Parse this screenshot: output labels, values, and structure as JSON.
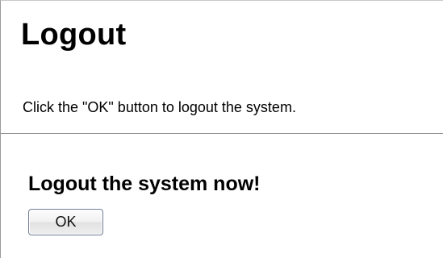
{
  "page": {
    "title": "Logout",
    "description": "Click the \"OK\" button to logout the system."
  },
  "logout_form": {
    "heading": "Logout the system now!",
    "ok_label": "OK"
  }
}
